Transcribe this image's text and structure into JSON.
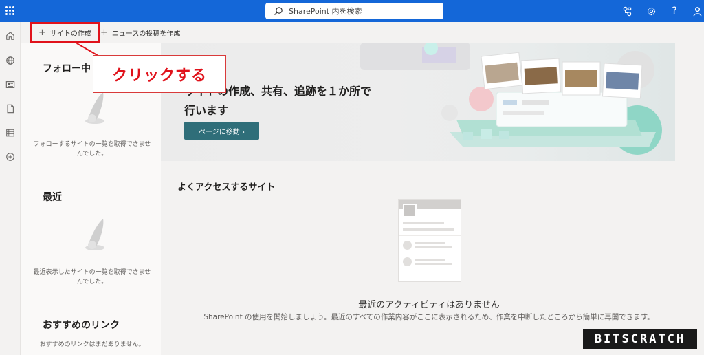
{
  "search": {
    "placeholder": "SharePoint 内を検索"
  },
  "commands": {
    "create_site": "サイトの作成",
    "create_news": "ニュースの投稿を作成"
  },
  "annotation": {
    "callout": "クリックする"
  },
  "left": {
    "following": {
      "title": "フォロー中",
      "desc": "フォローするサイトの一覧を取得できませんでした。"
    },
    "recent": {
      "title": "最近",
      "desc": "最近表示したサイトの一覧を取得できませんでした。"
    },
    "recommended": {
      "title": "おすすめのリンク",
      "desc": "おすすめのリンクはまだありません。"
    }
  },
  "hero": {
    "line1": "サイトの作成、共有、追跡を１か所で",
    "line2": "行います",
    "button": "ページに移動 ›"
  },
  "main": {
    "frequent_title": "よくアクセスするサイト",
    "no_activity": "最近のアクティビティはありません",
    "no_activity_desc": "SharePoint の使用を開始しましょう。最近のすべての作業内容がここに表示されるため、作業を中断したところから簡単に再開できます。"
  },
  "watermark": "BITSCRATCH",
  "colors": {
    "topbar": "#1467d8",
    "accent_button": "#2f6e79",
    "annotation_red": "#e0121b"
  },
  "icons": {
    "topbar": [
      "waffle-icon",
      "search-icon",
      "connections-icon",
      "settings-icon",
      "help-icon",
      "profile-icon"
    ],
    "rail": [
      "home-icon",
      "globe-icon",
      "news-icon",
      "document-icon",
      "list-icon",
      "add-circle-icon"
    ]
  }
}
